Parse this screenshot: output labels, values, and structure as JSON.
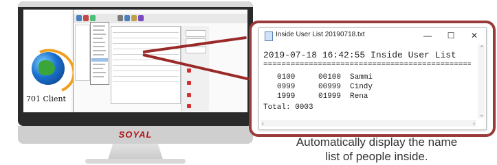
{
  "monitor": {
    "client_label": "701 Client",
    "brand": "SOYAL"
  },
  "notepad": {
    "title": "Inside User List 20190718.txt",
    "controls": {
      "minimize": "—",
      "maximize": "☐",
      "close": "✕"
    },
    "header_line": "2019-07-18 16:42:55 Inside User List",
    "separator": "================================================",
    "rows": [
      {
        "col1": "0100",
        "col2": "00100",
        "name": "Sammi"
      },
      {
        "col1": "0999",
        "col2": "00999",
        "name": "Cindy"
      },
      {
        "col1": "1999",
        "col2": "01999",
        "name": "Rena"
      }
    ],
    "total": "Total: 0003"
  },
  "caption": {
    "line1": "Automatically display the name",
    "line2": "list of people inside."
  },
  "colors": {
    "accent": "#9a3a3a",
    "brand": "#b01818"
  }
}
